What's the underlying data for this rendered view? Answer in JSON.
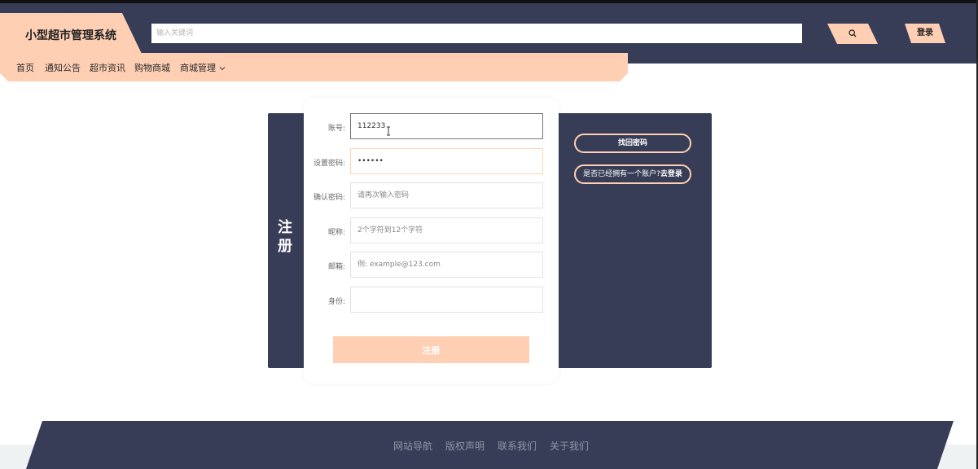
{
  "header": {
    "app_title": "小型超市管理系统",
    "search_placeholder": "输入关键词",
    "search_icon": "search-icon",
    "login_label": "登录"
  },
  "nav": {
    "items": [
      "首页",
      "通知公告",
      "超市资讯",
      "购物商城",
      "商城管理"
    ],
    "dropdown_icon": "chevron-down-icon"
  },
  "register": {
    "title": "注册",
    "fields": [
      {
        "label": "账号:",
        "value": "112233",
        "placeholder": ""
      },
      {
        "label": "设置密码:",
        "value": "••••••",
        "placeholder": ""
      },
      {
        "label": "确认密码:",
        "value": "",
        "placeholder": "请再次输入密码"
      },
      {
        "label": "昵称:",
        "value": "",
        "placeholder": "2个字符到12个字符"
      },
      {
        "label": "邮箱:",
        "value": "",
        "placeholder": "例: example@123.com"
      },
      {
        "label": "身份:",
        "value": "",
        "placeholder": ""
      }
    ],
    "submit_label": "注册",
    "forgot_label": "找回密码",
    "have_account_text": "是否已经拥有一个账户?",
    "go_login_label": "去登录"
  },
  "footer": {
    "links": [
      "网站导航",
      "版权声明",
      "联系我们",
      "关于我们"
    ]
  },
  "colors": {
    "navy": "#373d56",
    "peach": "#ffcfb4"
  }
}
